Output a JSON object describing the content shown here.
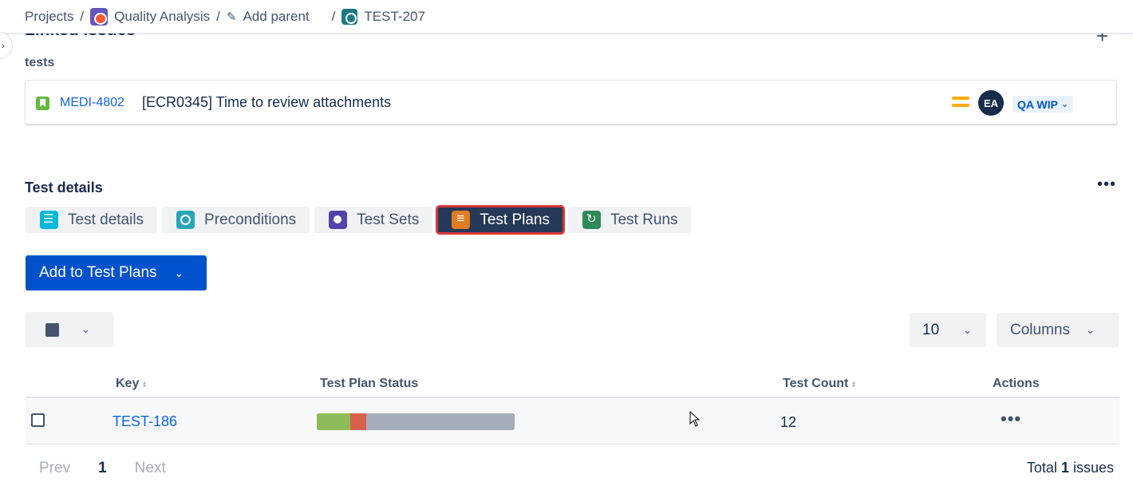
{
  "breadcrumb": {
    "projects": "Projects",
    "project_name": "Quality Analysis",
    "add_parent": "Add parent",
    "issue_key": "TEST-207"
  },
  "linked_issues": {
    "title": "Linked issues",
    "relation": "tests",
    "items": [
      {
        "key": "MEDI-4802",
        "summary": "[ECR0345] Time to review attachments",
        "assignee_initials": "EA",
        "status": "QA WIP",
        "priority_icon": "medium-priority-icon",
        "type_icon": "story-icon"
      }
    ]
  },
  "test_details": {
    "title": "Test details",
    "tabs": [
      {
        "label": "Test details",
        "icon": "test-details-icon"
      },
      {
        "label": "Preconditions",
        "icon": "preconditions-icon"
      },
      {
        "label": "Test Sets",
        "icon": "test-sets-icon"
      },
      {
        "label": "Test Plans",
        "icon": "test-plans-icon",
        "active": true
      },
      {
        "label": "Test Runs",
        "icon": "test-runs-icon"
      }
    ],
    "add_button": "Add to Test Plans",
    "page_size": "10",
    "columns_button": "Columns",
    "table": {
      "headers": [
        "Key",
        "Test Plan Status",
        "Test Count",
        "Actions"
      ],
      "rows": [
        {
          "key": "TEST-186",
          "status_segments": [
            {
              "fraction": 0.17,
              "color": "#8fbc5a"
            },
            {
              "fraction": 0.08,
              "color": "#d9604c"
            },
            {
              "fraction": 0.75,
              "color": "#a5adba"
            }
          ],
          "test_count": "12",
          "actions": "•••"
        }
      ]
    },
    "pagination": {
      "prev": "Prev",
      "current": "1",
      "next": "Next",
      "total_prefix": "Total",
      "total_count": "1",
      "total_suffix": "issues"
    }
  },
  "colors": {
    "primary": "#0052cc",
    "active_tab_bg": "#253858",
    "highlight_border": "#d93838"
  }
}
